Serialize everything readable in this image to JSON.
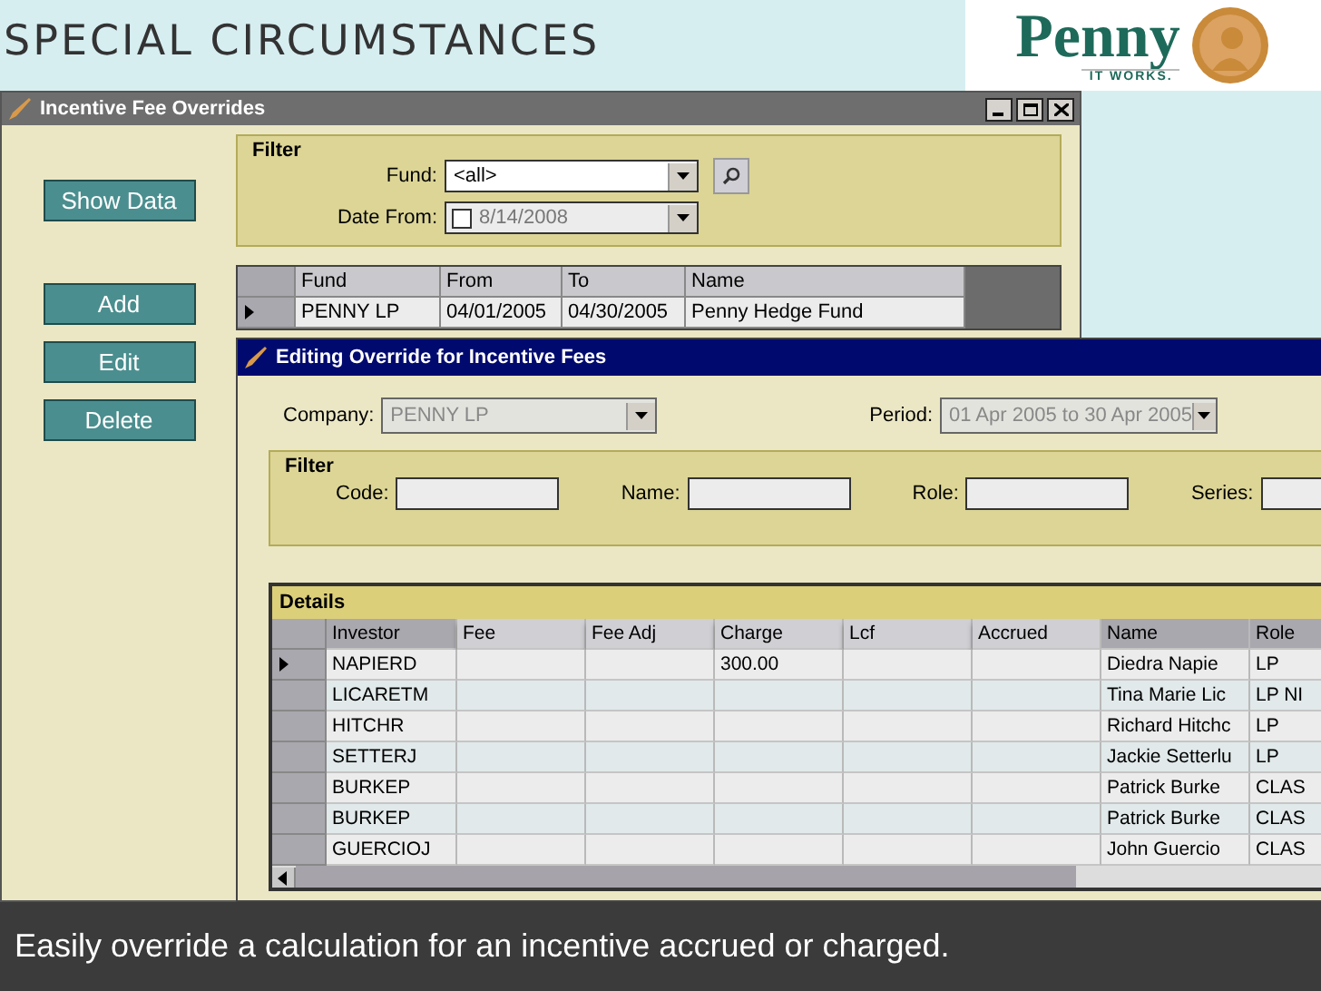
{
  "slide": {
    "title": "SPECIAL CIRCUMSTANCES",
    "logo": {
      "name": "Penny",
      "tagline": "IT WORKS."
    },
    "caption": "Easily override a calculation for an incentive accrued or charged."
  },
  "main_window": {
    "title": "Incentive Fee Overrides",
    "buttons": [
      "Show Data",
      "Add",
      "Edit",
      "Delete"
    ],
    "filter": {
      "title": "Filter",
      "fund_label": "Fund:",
      "fund_value": "<all>",
      "date_label": "Date From:",
      "date_checked": false,
      "date_value": "8/14/2008"
    },
    "grid": {
      "columns": [
        "Fund",
        "From",
        "To",
        "Name"
      ],
      "rows": [
        {
          "selected": true,
          "cells": [
            "PENNY LP",
            "04/01/2005",
            "04/30/2005",
            "Penny Hedge Fund"
          ]
        }
      ]
    }
  },
  "dialog": {
    "title": "Editing Override for Incentive Fees",
    "company": {
      "label": "Company:",
      "value": "PENNY LP",
      "disabled": true
    },
    "period": {
      "label": "Period:",
      "value": "01 Apr 2005 to 30 Apr 2005",
      "disabled": true
    },
    "filter": {
      "title": "Filter",
      "fields": [
        {
          "label": "Code:"
        },
        {
          "label": "Name:"
        },
        {
          "label": "Role:"
        },
        {
          "label": "Series:"
        }
      ]
    },
    "details": {
      "title": "Details",
      "columns": [
        "Investor",
        "Fee",
        "Fee Adj",
        "Charge",
        "Lcf",
        "Accrued",
        "Name",
        "Role"
      ],
      "rows": [
        {
          "selected": true,
          "cells": [
            "NAPIERD",
            "",
            "",
            "300.00",
            "",
            "",
            "Diedra Napie",
            "LP"
          ]
        },
        {
          "selected": false,
          "cells": [
            "LICARETM",
            "",
            "",
            "",
            "",
            "",
            "Tina Marie Lic",
            "LP NI"
          ]
        },
        {
          "selected": false,
          "cells": [
            "HITCHR",
            "",
            "",
            "",
            "",
            "",
            "Richard Hitchc",
            "LP"
          ]
        },
        {
          "selected": false,
          "cells": [
            "SETTERJ",
            "",
            "",
            "",
            "",
            "",
            "Jackie Setterlu",
            "LP"
          ]
        },
        {
          "selected": false,
          "cells": [
            "BURKEP",
            "",
            "",
            "",
            "",
            "",
            "Patrick Burke",
            "CLAS"
          ]
        },
        {
          "selected": false,
          "cells": [
            "BURKEP",
            "",
            "",
            "",
            "",
            "",
            "Patrick Burke",
            "CLAS"
          ]
        },
        {
          "selected": false,
          "cells": [
            "GUERCIOJ",
            "",
            "",
            "",
            "",
            "",
            "John Guercio",
            "CLAS"
          ]
        }
      ]
    }
  }
}
